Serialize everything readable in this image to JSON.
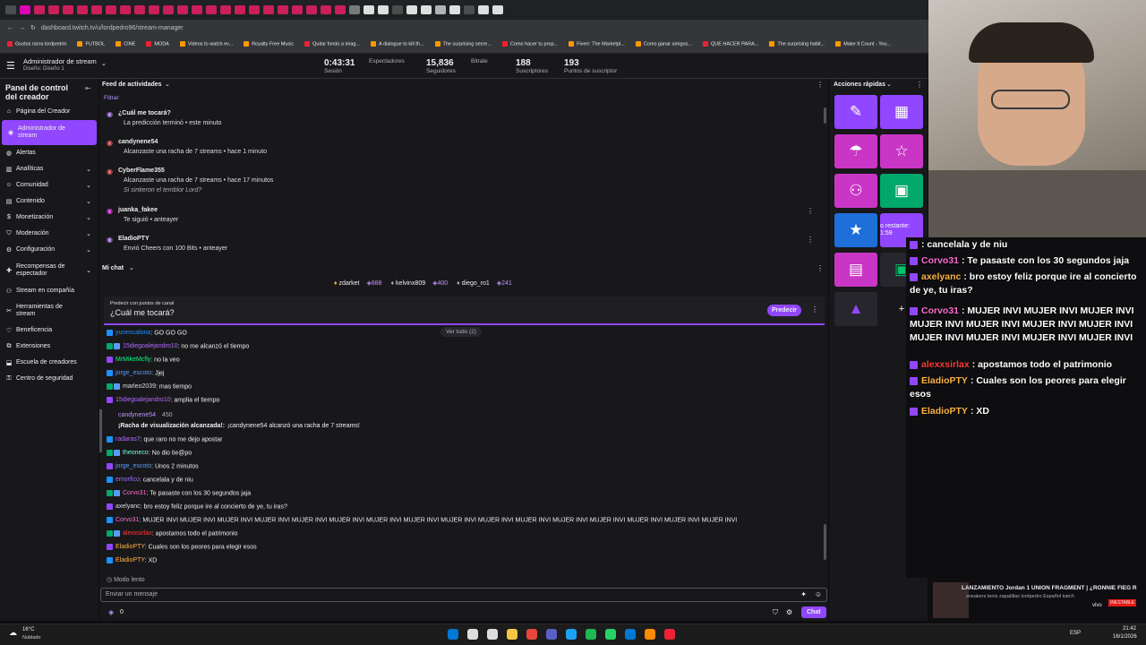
{
  "browser": {
    "url": "dashboard.twitch.tv/u/lordpedro96/stream-manager",
    "bookmarks": [
      "Gustos raros lordpedrin",
      "FUTBOL",
      "CINE",
      "MODA",
      "Videos to watch ev...",
      "Royalty Free Music",
      "Quitar fondo a imag...",
      "A dialogue to kill th...",
      "The surprising secre...",
      "Como hacer tu prop...",
      "Fiverr: The Marketpl...",
      "Como ganar amigos...",
      "QUE HACER PARA...",
      "The surprising habit...",
      "Make It Count - You..."
    ]
  },
  "header": {
    "title": "Administrador de stream",
    "subtitle": "Diseño: Diseño 1",
    "stats": [
      {
        "v": "0:43:31",
        "l": "Sesión"
      },
      {
        "v": "",
        "l": "Espectadores"
      },
      {
        "v": "15,836",
        "l": "Seguidores"
      },
      {
        "v": "",
        "l": "Bitrate"
      },
      {
        "v": "188",
        "l": "Suscriptores"
      },
      {
        "v": "193",
        "l": "Puntos de suscriptor"
      }
    ]
  },
  "sidebar": {
    "title": "Panel de control del creador",
    "items": [
      {
        "label": "Página del Creador",
        "icon": "home-icon",
        "chev": false
      },
      {
        "label": "Administrador de stream",
        "icon": "broadcast-icon",
        "chev": false,
        "active": true
      },
      {
        "label": "Alertas",
        "icon": "alert-icon",
        "chev": false
      },
      {
        "label": "Analíticas",
        "icon": "chart-icon",
        "chev": true
      },
      {
        "label": "Comunidad",
        "icon": "community-icon",
        "chev": true
      },
      {
        "label": "Contenido",
        "icon": "content-icon",
        "chev": true
      },
      {
        "label": "Monetización",
        "icon": "money-icon",
        "chev": true
      },
      {
        "label": "Moderación",
        "icon": "shield-icon",
        "chev": true
      },
      {
        "label": "Configuración",
        "icon": "gear-icon",
        "chev": true
      },
      {
        "label": "Recompensas de espectador",
        "icon": "gift-icon",
        "chev": true
      },
      {
        "label": "Stream en compañía",
        "icon": "together-icon",
        "chev": false
      },
      {
        "label": "Herramientas de stream",
        "icon": "tools-icon",
        "chev": false
      },
      {
        "label": "Beneficencia",
        "icon": "heart-icon",
        "chev": false
      },
      {
        "label": "Extensiones",
        "icon": "puzzle-icon",
        "chev": false
      },
      {
        "label": "Escuela de creadores",
        "icon": "school-icon",
        "chev": false
      },
      {
        "label": "Centro de seguridad",
        "icon": "lock-icon",
        "chev": false
      }
    ]
  },
  "feed": {
    "title": "Feed de actividades",
    "filter": "Filtrar",
    "items": [
      {
        "name": "¿Cuál me tocará?",
        "desc": "La predicción terminó • este minuto",
        "quote": "",
        "color": "#bf94ff"
      },
      {
        "name": "candynene54",
        "desc": "Alcanzaste una racha de 7 streams • hace 1 minuto",
        "quote": "",
        "color": "#ff6b6b"
      },
      {
        "name": "CyberFlame355",
        "desc": "Alcanzaste una racha de 7 streams • hace 17 minutos",
        "quote": "Si sintieron el temblor Lord?",
        "color": "#ff6b6b"
      },
      {
        "name": "juanka_fakee",
        "desc": "Te siguió • anteayer",
        "quote": "",
        "color": "#ff4dff"
      },
      {
        "name": "EladioPTY",
        "desc": "Envió Cheers con 100 Bits • anteayer",
        "quote": "",
        "color": "#bf94ff"
      }
    ]
  },
  "chat": {
    "title": "Mi chat",
    "leaders": [
      {
        "name": "zdarket",
        "pts": "888"
      },
      {
        "name": "kelvinx809",
        "pts": "400"
      },
      {
        "name": "diego_ro1",
        "pts": "241"
      }
    ],
    "prediction": {
      "label": "Predecir con puntos de canal",
      "question": "¿Cuál me tocará?",
      "button": "Predecir",
      "see_all": "Ver todo (2)"
    },
    "messages": [
      {
        "u": "yunescalona",
        "c": "#1e90ff",
        "t": "GO GO GO"
      },
      {
        "u": "15diegoalejandro10",
        "c": "#b26bff",
        "t": "no me alcanzó el tiempo"
      },
      {
        "u": "MrMikeMcfly",
        "c": "#00ff7f",
        "t": "no la veo"
      },
      {
        "u": "jorge_escoto",
        "c": "#5b9bff",
        "t": "Jjej"
      },
      {
        "u": "marleo2039",
        "c": "#dedee3",
        "t": "mas tiempo"
      },
      {
        "u": "15diegoalejandro10",
        "c": "#b26bff",
        "t": "amplia el tiempo"
      },
      {
        "u": "radaras7",
        "c": "#b26bff",
        "t": "que raro no me dejo apostar"
      },
      {
        "u": "theoneco",
        "c": "#7fffd4",
        "t": "No dio tie@po"
      },
      {
        "u": "jorge_escoto",
        "c": "#5b9bff",
        "t": "Unos 2 minutos"
      },
      {
        "u": "emorfico",
        "c": "#9c6bff",
        "t": "cancelala y de niu"
      },
      {
        "u": "Corvo31",
        "c": "#ff6bd0",
        "t": "Te pasaste con los 30 segundos jaja"
      },
      {
        "u": "axelyanc",
        "c": "#dedee3",
        "t": "bro estoy feliz porque ire al concierto de ye, tu iras?"
      },
      {
        "u": "Corvo31",
        "c": "#ff6bd0",
        "t": "MUJER INVI MUJER INVI MUJER INVI MUJER INVI MUJER INVI MUJER INVI MUJER INVI MUJER INVI MUJER INVI MUJER INVI MUJER INVI MUJER INVI MUJER INVI MUJER INVI MUJER INVI MUJER INVI"
      },
      {
        "u": "alexxsirlax",
        "c": "#ff3b3b",
        "t": "apostamos todo el patrimonio"
      },
      {
        "u": "EladioPTY",
        "c": "#ffb347",
        "t": "Cuales son los peores para elegir esos"
      },
      {
        "u": "EladioPTY",
        "c": "#ffb347",
        "t": "XD"
      }
    ],
    "streak": {
      "user": "candynene54",
      "extra": "450",
      "title": "¡Racha de visualización alcanzada!:",
      "text": "¡candynene54 alcanzó una racha de 7 streams!"
    },
    "slow": "Modo lento",
    "placeholder": "Enviar un mensaje",
    "points": "0",
    "send": "Chat"
  },
  "quick_actions": {
    "title": "Acciones rápidas",
    "timer": "o restante: 1:59"
  },
  "overlay": {
    "lines": [
      {
        "u": "",
        "t": ": cancelala y de niu"
      },
      {
        "u": "Corvo31",
        "c": "#ff6bd0",
        "t": ": Te pasaste con los 30 segundos jaja"
      },
      {
        "u": "axelyanc",
        "c": "#ffb347",
        "t": ": bro estoy feliz porque ire al concierto de ye, tu iras?"
      },
      {
        "u": "Corvo31",
        "c": "#ff6bd0",
        "t": ": MUJER INVI MUJER INVI MUJER INVI MUJER INVI MUJER INVI MUJER INVI MUJER INVI MUJER INVI MUJER INVI MUJER INVI MUJER INVI"
      },
      {
        "u": "alexxsirlax",
        "c": "#ff3b3b",
        "t": ": apostamos todo el patrimonio"
      },
      {
        "u": "EladioPTY",
        "c": "#ffb347",
        "t": ": Cuales son los peores para elegir esos"
      },
      {
        "u": "EladioPTY",
        "c": "#ffb347",
        "t": ": XD"
      }
    ],
    "music": "LANZAMIENTO Jordan 1 UNION FRAGMENT | ¿RONNIE FIEG R",
    "tags": "sneakers  tenis  zapatillas  lordpedro  Español  katch",
    "live": "vivo",
    "badge": "INESTABLE"
  },
  "taskbar": {
    "weather_temp": "16°C",
    "weather_desc": "Nublado",
    "lang": "ESP",
    "time": "21:42",
    "date": "16/1/2026"
  }
}
